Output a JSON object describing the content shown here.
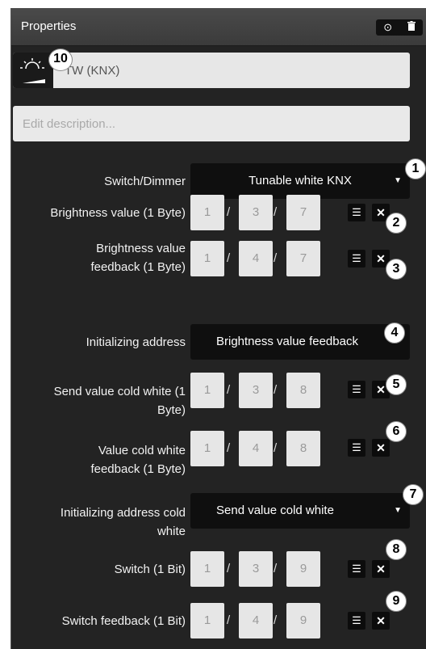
{
  "header": {
    "title": "Properties"
  },
  "name_field": {
    "value": "TW (KNX)"
  },
  "description": {
    "placeholder": "Edit description..."
  },
  "rows": {
    "switch_dimmer": {
      "label": "Switch/Dimmer",
      "value": "Tunable white KNX"
    },
    "brightness_value": {
      "label": "Brightness value (1 Byte)",
      "a": "1",
      "b": "3",
      "c": "7"
    },
    "brightness_feedback": {
      "label1": "Brightness value",
      "label2": "feedback (1 Byte)",
      "a": "1",
      "b": "4",
      "c": "7"
    },
    "init_address": {
      "label": "Initializing address",
      "value": "Brightness value feedback"
    },
    "send_cold_white": {
      "label1": "Send value cold white (1",
      "label2": "Byte)",
      "a": "1",
      "b": "3",
      "c": "8"
    },
    "cold_white_feedback": {
      "label1": "Value cold white",
      "label2": "feedback (1 Byte)",
      "a": "1",
      "b": "4",
      "c": "8"
    },
    "init_address_cold": {
      "label1": "Initializing address cold",
      "label2": "white",
      "value": "Send value cold white"
    },
    "switch": {
      "label": "Switch (1 Bit)",
      "a": "1",
      "b": "3",
      "c": "9"
    },
    "switch_feedback": {
      "label": "Switch feedback (1 Bit)",
      "a": "1",
      "b": "4",
      "c": "9"
    }
  },
  "slash": "/",
  "callouts": [
    "1",
    "2",
    "3",
    "4",
    "5",
    "6",
    "7",
    "8",
    "9",
    "10"
  ]
}
